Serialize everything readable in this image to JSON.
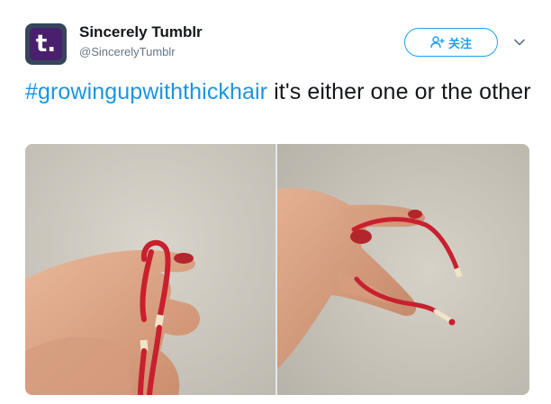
{
  "account": {
    "display_name": "Sincerely Tumblr",
    "screen_name": "@SincerelyTumblr",
    "avatar_letter": "t."
  },
  "follow_button": {
    "label": "关注",
    "icon": "add-user-icon"
  },
  "more_menu": {
    "icon": "chevron-down-icon"
  },
  "tweet": {
    "hashtag": "#growingupwiththickhair",
    "text": " it's either one or the other"
  },
  "media": {
    "photos": [
      {
        "subject": "hand holding hair tie"
      },
      {
        "subject": "hand holding broken hair tie"
      }
    ]
  },
  "colors": {
    "accent": "#1da1f2",
    "hashtag": "#1b95e0",
    "avatar_bg": "#35465c",
    "hair_tie": "#c8202e"
  }
}
